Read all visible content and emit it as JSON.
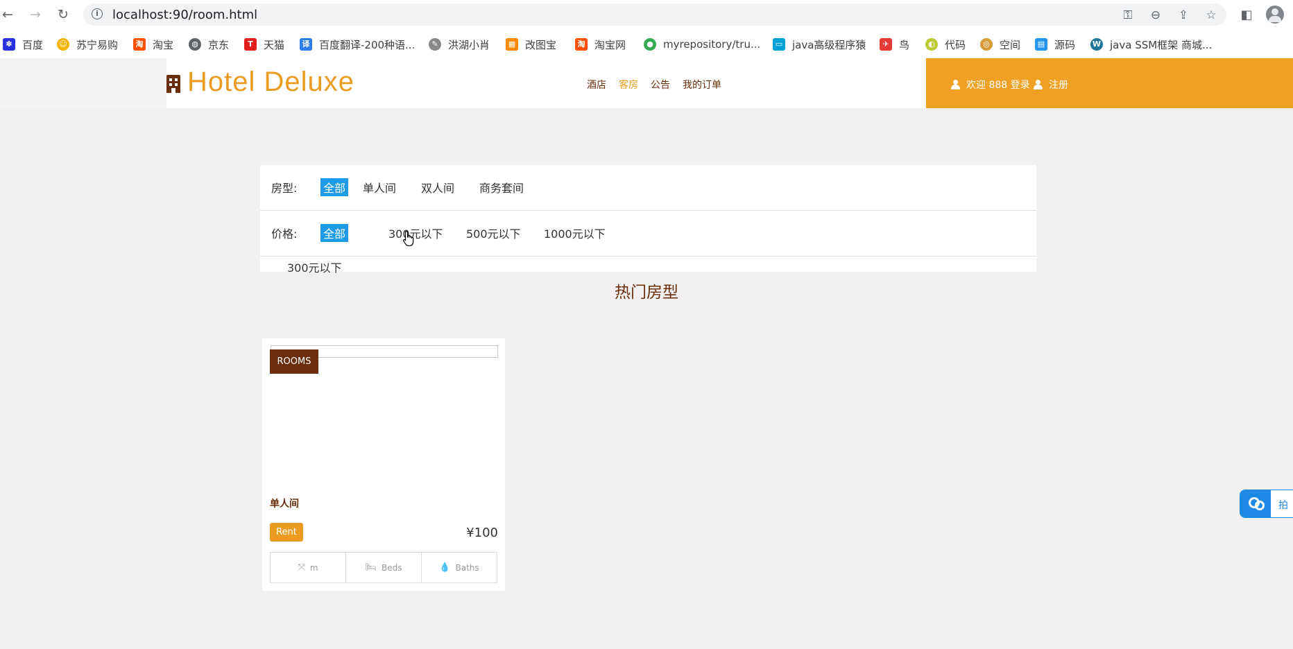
{
  "browser": {
    "url": "localhost:90/room.html",
    "bookmarks": [
      {
        "label": "百度",
        "icon": "baidu-paw-icon",
        "color": "#2932e1"
      },
      {
        "label": "苏宁易购",
        "icon": "suning-lion-icon",
        "color": "#f4b400"
      },
      {
        "label": "淘宝",
        "icon": "taobao-icon",
        "color": "#ff5000"
      },
      {
        "label": "京东",
        "icon": "globe-icon",
        "color": "#5f6368"
      },
      {
        "label": "天猫",
        "icon": "tmall-icon",
        "color": "#e11d1d"
      },
      {
        "label": "百度翻译-200种语...",
        "icon": "translate-icon",
        "color": "#2b7de9"
      },
      {
        "label": "洪湖小肖",
        "icon": "bird-icon",
        "color": "#888888"
      },
      {
        "label": "改图宝",
        "icon": "gaitubao-icon",
        "color": "#ff8a00"
      },
      {
        "label": "淘宝网",
        "icon": "taobao-icon",
        "color": "#ff5000"
      },
      {
        "label": "myrepository/tru...",
        "icon": "chrome-icon",
        "color": "#34a853"
      },
      {
        "label": "java高级程序猿",
        "icon": "bilibili-icon",
        "color": "#00a1d6"
      },
      {
        "label": "鸟",
        "icon": "hummingbird-icon",
        "color": "#e53935"
      },
      {
        "label": "代码",
        "icon": "leaf-icon",
        "color": "#c0ca33"
      },
      {
        "label": "空间",
        "icon": "space-icon",
        "color": "#d89b3a"
      },
      {
        "label": "源码",
        "icon": "docker-icon",
        "color": "#2496ed"
      },
      {
        "label": "java SSM框架 商城...",
        "icon": "wordpress-icon",
        "color": "#21759b"
      }
    ]
  },
  "site": {
    "logo": "Hotel Deluxe",
    "nav": [
      {
        "label": "酒店",
        "active": false
      },
      {
        "label": "客房",
        "active": true
      },
      {
        "label": "公告",
        "active": false
      },
      {
        "label": "我的订单",
        "active": false
      }
    ],
    "user": {
      "welcome": "欢迎 888 登录",
      "register": "注册"
    },
    "accent_color": "#f0a023",
    "brand_color": "#6b2e0b"
  },
  "filters": {
    "room_type": {
      "label": "房型:",
      "options": [
        "全部",
        "单人间",
        "双人间",
        "商务套间"
      ],
      "selected": "全部"
    },
    "price": {
      "label": "价格:",
      "options": [
        "全部",
        "300元以下",
        "500元以下",
        "1000元以下"
      ],
      "selected": "全部"
    },
    "result_text": "300元以下"
  },
  "section_title": "热门房型",
  "rooms": [
    {
      "tag": "ROOMS",
      "name": "单人间",
      "rent_label": "Rent",
      "price": "¥100",
      "meta": [
        {
          "icon": "expand-arrows-icon",
          "label": "m"
        },
        {
          "icon": "bed-icon",
          "label": "Beds"
        },
        {
          "icon": "water-drop-icon",
          "label": "Baths"
        }
      ]
    }
  ],
  "side_widget": {
    "text": "拍"
  }
}
